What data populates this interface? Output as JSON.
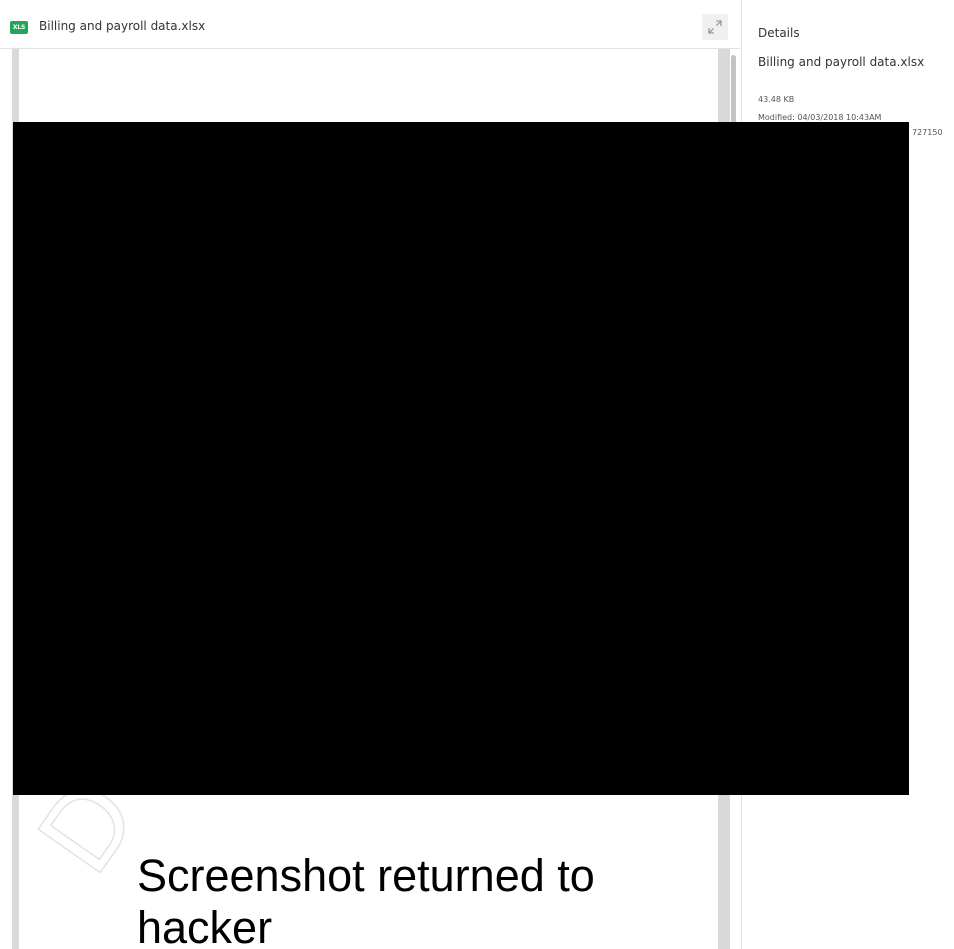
{
  "preview": {
    "file_type_badge": "XLS",
    "file_title": "Billing and payroll data.xlsx",
    "expand_icon": "expand-arrows-icon"
  },
  "details": {
    "heading": "Details",
    "file_name": "Billing and payroll data.xlsx",
    "file_size": "43.48 KB",
    "modified": "Modified: 04/03/2018 10:43AM",
    "id_fragment": "727150"
  },
  "overlay": {
    "caption": "Screenshot returned to hacker"
  },
  "colors": {
    "xls_badge": "#1fa65a",
    "redaction": "#000000",
    "gutter": "#d9d9d9"
  }
}
